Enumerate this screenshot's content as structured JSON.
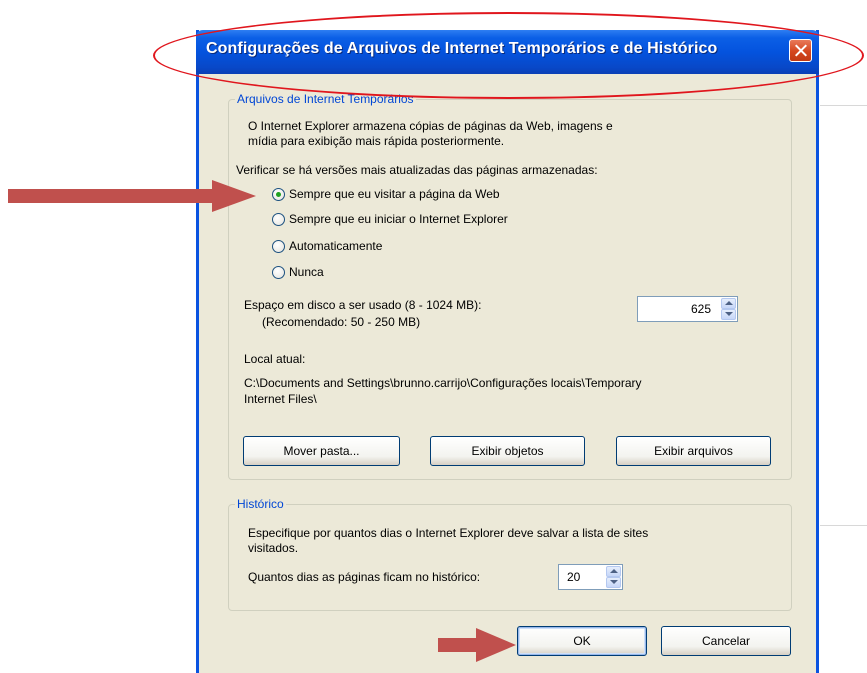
{
  "dialog": {
    "title": "Configurações de Arquivos de Internet Temporários e de Histórico"
  },
  "temp_files": {
    "legend": "Arquivos de Internet Temporários",
    "description_line1": "O Internet Explorer armazena cópias de páginas da Web, imagens e",
    "description_line2": "mídia para exibição mais rápida posteriormente.",
    "check_label": "Verificar se há versões mais atualizadas das páginas armazenadas:",
    "options": [
      {
        "label": "Sempre que eu visitar a página da Web",
        "checked": true
      },
      {
        "label": "Sempre que eu iniciar o Internet Explorer",
        "checked": false
      },
      {
        "label": "Automaticamente",
        "checked": false
      },
      {
        "label": "Nunca",
        "checked": false
      }
    ],
    "disk_space_label": "Espaço em disco a ser usado (8 - 1024 MB):",
    "disk_space_recommended": "(Recomendado: 50 - 250 MB)",
    "disk_space_value": "625",
    "current_location_label": "Local atual:",
    "current_location_line1": "C:\\Documents and Settings\\brunno.carrijo\\Configurações locais\\Temporary",
    "current_location_line2": "Internet Files\\",
    "buttons": {
      "move_folder": "Mover pasta...",
      "view_objects": "Exibir objetos",
      "view_files": "Exibir arquivos"
    }
  },
  "history": {
    "legend": "Histórico",
    "description_line1": "Especifique por quantos dias o Internet Explorer deve salvar a lista de sites",
    "description_line2": "visitados.",
    "days_label": "Quantos dias as páginas ficam no histórico:",
    "days_value": "20"
  },
  "footer": {
    "ok": "OK",
    "cancel": "Cancelar"
  },
  "annotations": {
    "arrow_color": "#c0504d",
    "ellipse_color": "#e0161d"
  }
}
